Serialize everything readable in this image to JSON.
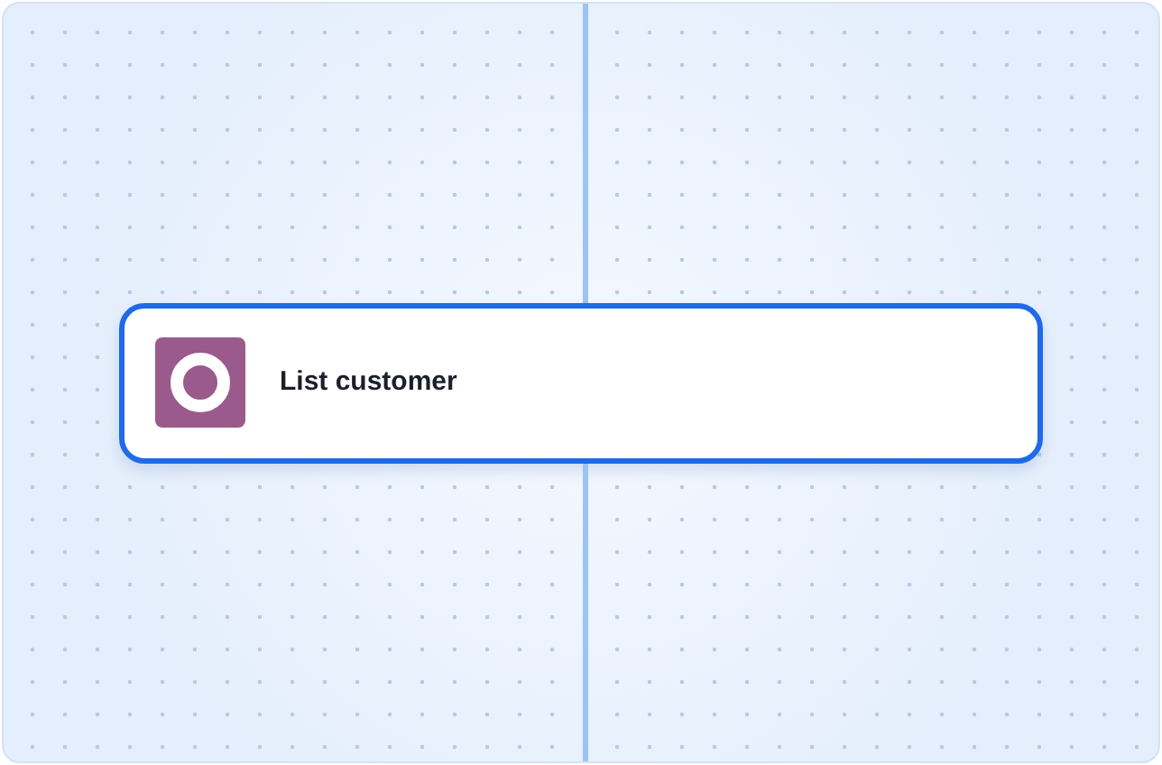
{
  "node": {
    "title": "List customer"
  }
}
